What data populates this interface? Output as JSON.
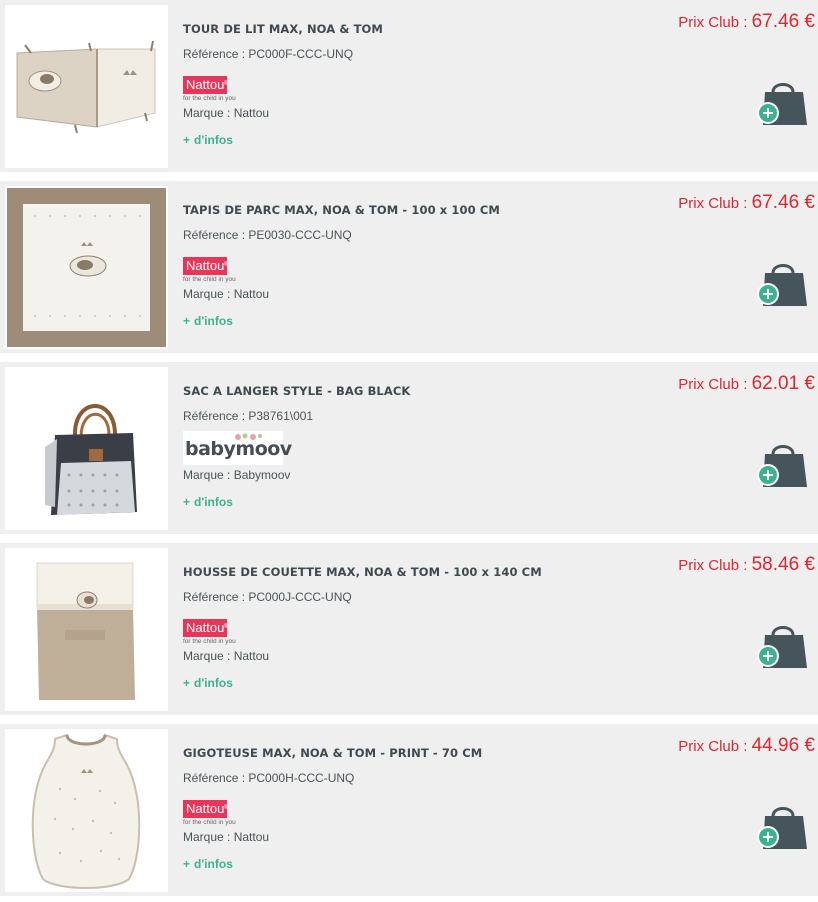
{
  "labels": {
    "ref_prefix": "Référence : ",
    "brand_prefix": "Marque : ",
    "more_plus": "+",
    "more_info": "d'infos",
    "price_label": "Prix Club : "
  },
  "logos": {
    "nattou_name": "Nattou",
    "nattou_mark": "®",
    "nattou_tagline": "for the child in you",
    "babymoov_name": "babymoov"
  },
  "colors": {
    "price": "#e0262f",
    "more_link": "#3bb38f",
    "cart_bag": "#46555b",
    "cart_plus": "#3bb38f",
    "nattou": "#e8365a"
  },
  "products": [
    {
      "title": "TOUR DE LIT MAX, NOA & TOM",
      "reference": "PC000F-CCC-UNQ",
      "brand": "Nattou",
      "price": "67.46 €",
      "image": "cot-bumper"
    },
    {
      "title": "TAPIS DE PARC MAX, NOA & TOM - 100 x 100 CM",
      "reference": "PE0030-CCC-UNQ",
      "brand": "Nattou",
      "price": "67.46 €",
      "image": "playpen-mat"
    },
    {
      "title": "SAC A LANGER STYLE - BAG BLACK",
      "reference": "P38761\\001",
      "brand": "Babymoov",
      "price": "62.01 €",
      "image": "changing-bag"
    },
    {
      "title": "HOUSSE DE COUETTE MAX, NOA & TOM - 100 x 140 CM",
      "reference": "PC000J-CCC-UNQ",
      "brand": "Nattou",
      "price": "58.46 €",
      "image": "duvet-cover"
    },
    {
      "title": "GIGOTEUSE MAX, NOA & TOM - PRINT - 70 CM",
      "reference": "PC000H-CCC-UNQ",
      "brand": "Nattou",
      "price": "44.96 €",
      "image": "sleeping-bag"
    }
  ]
}
